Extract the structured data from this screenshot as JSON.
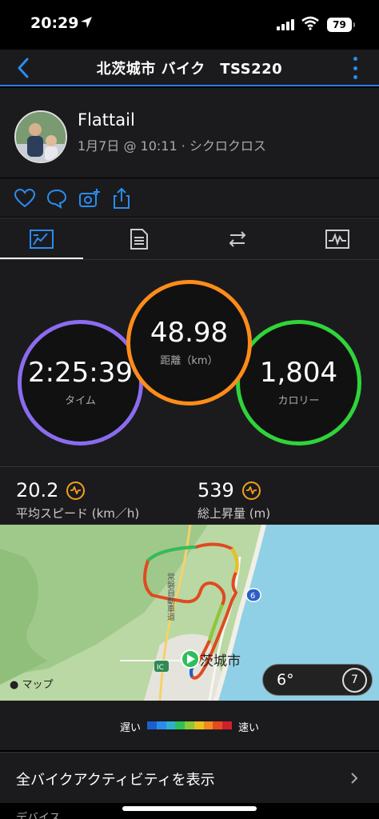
{
  "status": {
    "time": "20:29",
    "battery": "79"
  },
  "nav": {
    "title": "北茨城市 バイク　TSS220"
  },
  "profile": {
    "name": "Flattail",
    "meta": "1月7日 @ 10:11 · シクロクロス"
  },
  "stats": {
    "time": {
      "value": "2:25:39",
      "label": "タイム"
    },
    "distance": {
      "value": "48.98",
      "label": "距離（km）"
    },
    "calories": {
      "value": "1,804",
      "label": "カロリー"
    },
    "avg_speed": {
      "value": "20.2",
      "label": "平均スピード (km／h)"
    },
    "elevation": {
      "value": "539",
      "label": "総上昇量 (m)"
    }
  },
  "map": {
    "attribution": "マップ",
    "city_label": "茨城市",
    "road_label": "常磐自動車道",
    "route_badge": "6",
    "ic_badge": "IC",
    "temperature": "6°",
    "wind": "7"
  },
  "legend": {
    "slow": "遅い",
    "fast": "速い",
    "colors": [
      "#1a5fd0",
      "#2a8ce8",
      "#2fb0d0",
      "#2fbf5a",
      "#8cc83a",
      "#e8c020",
      "#f08a20",
      "#e84a20",
      "#d0202a"
    ]
  },
  "links": {
    "all_activities": "全バイクアクティビティを表示",
    "device": "デバイス"
  },
  "colors": {
    "accent": "#2a7ef0",
    "time_ring": "#8b6cf0",
    "distance_ring": "#ff8c1a",
    "calorie_ring": "#2fd43a",
    "te_icon": "#f0a020"
  }
}
